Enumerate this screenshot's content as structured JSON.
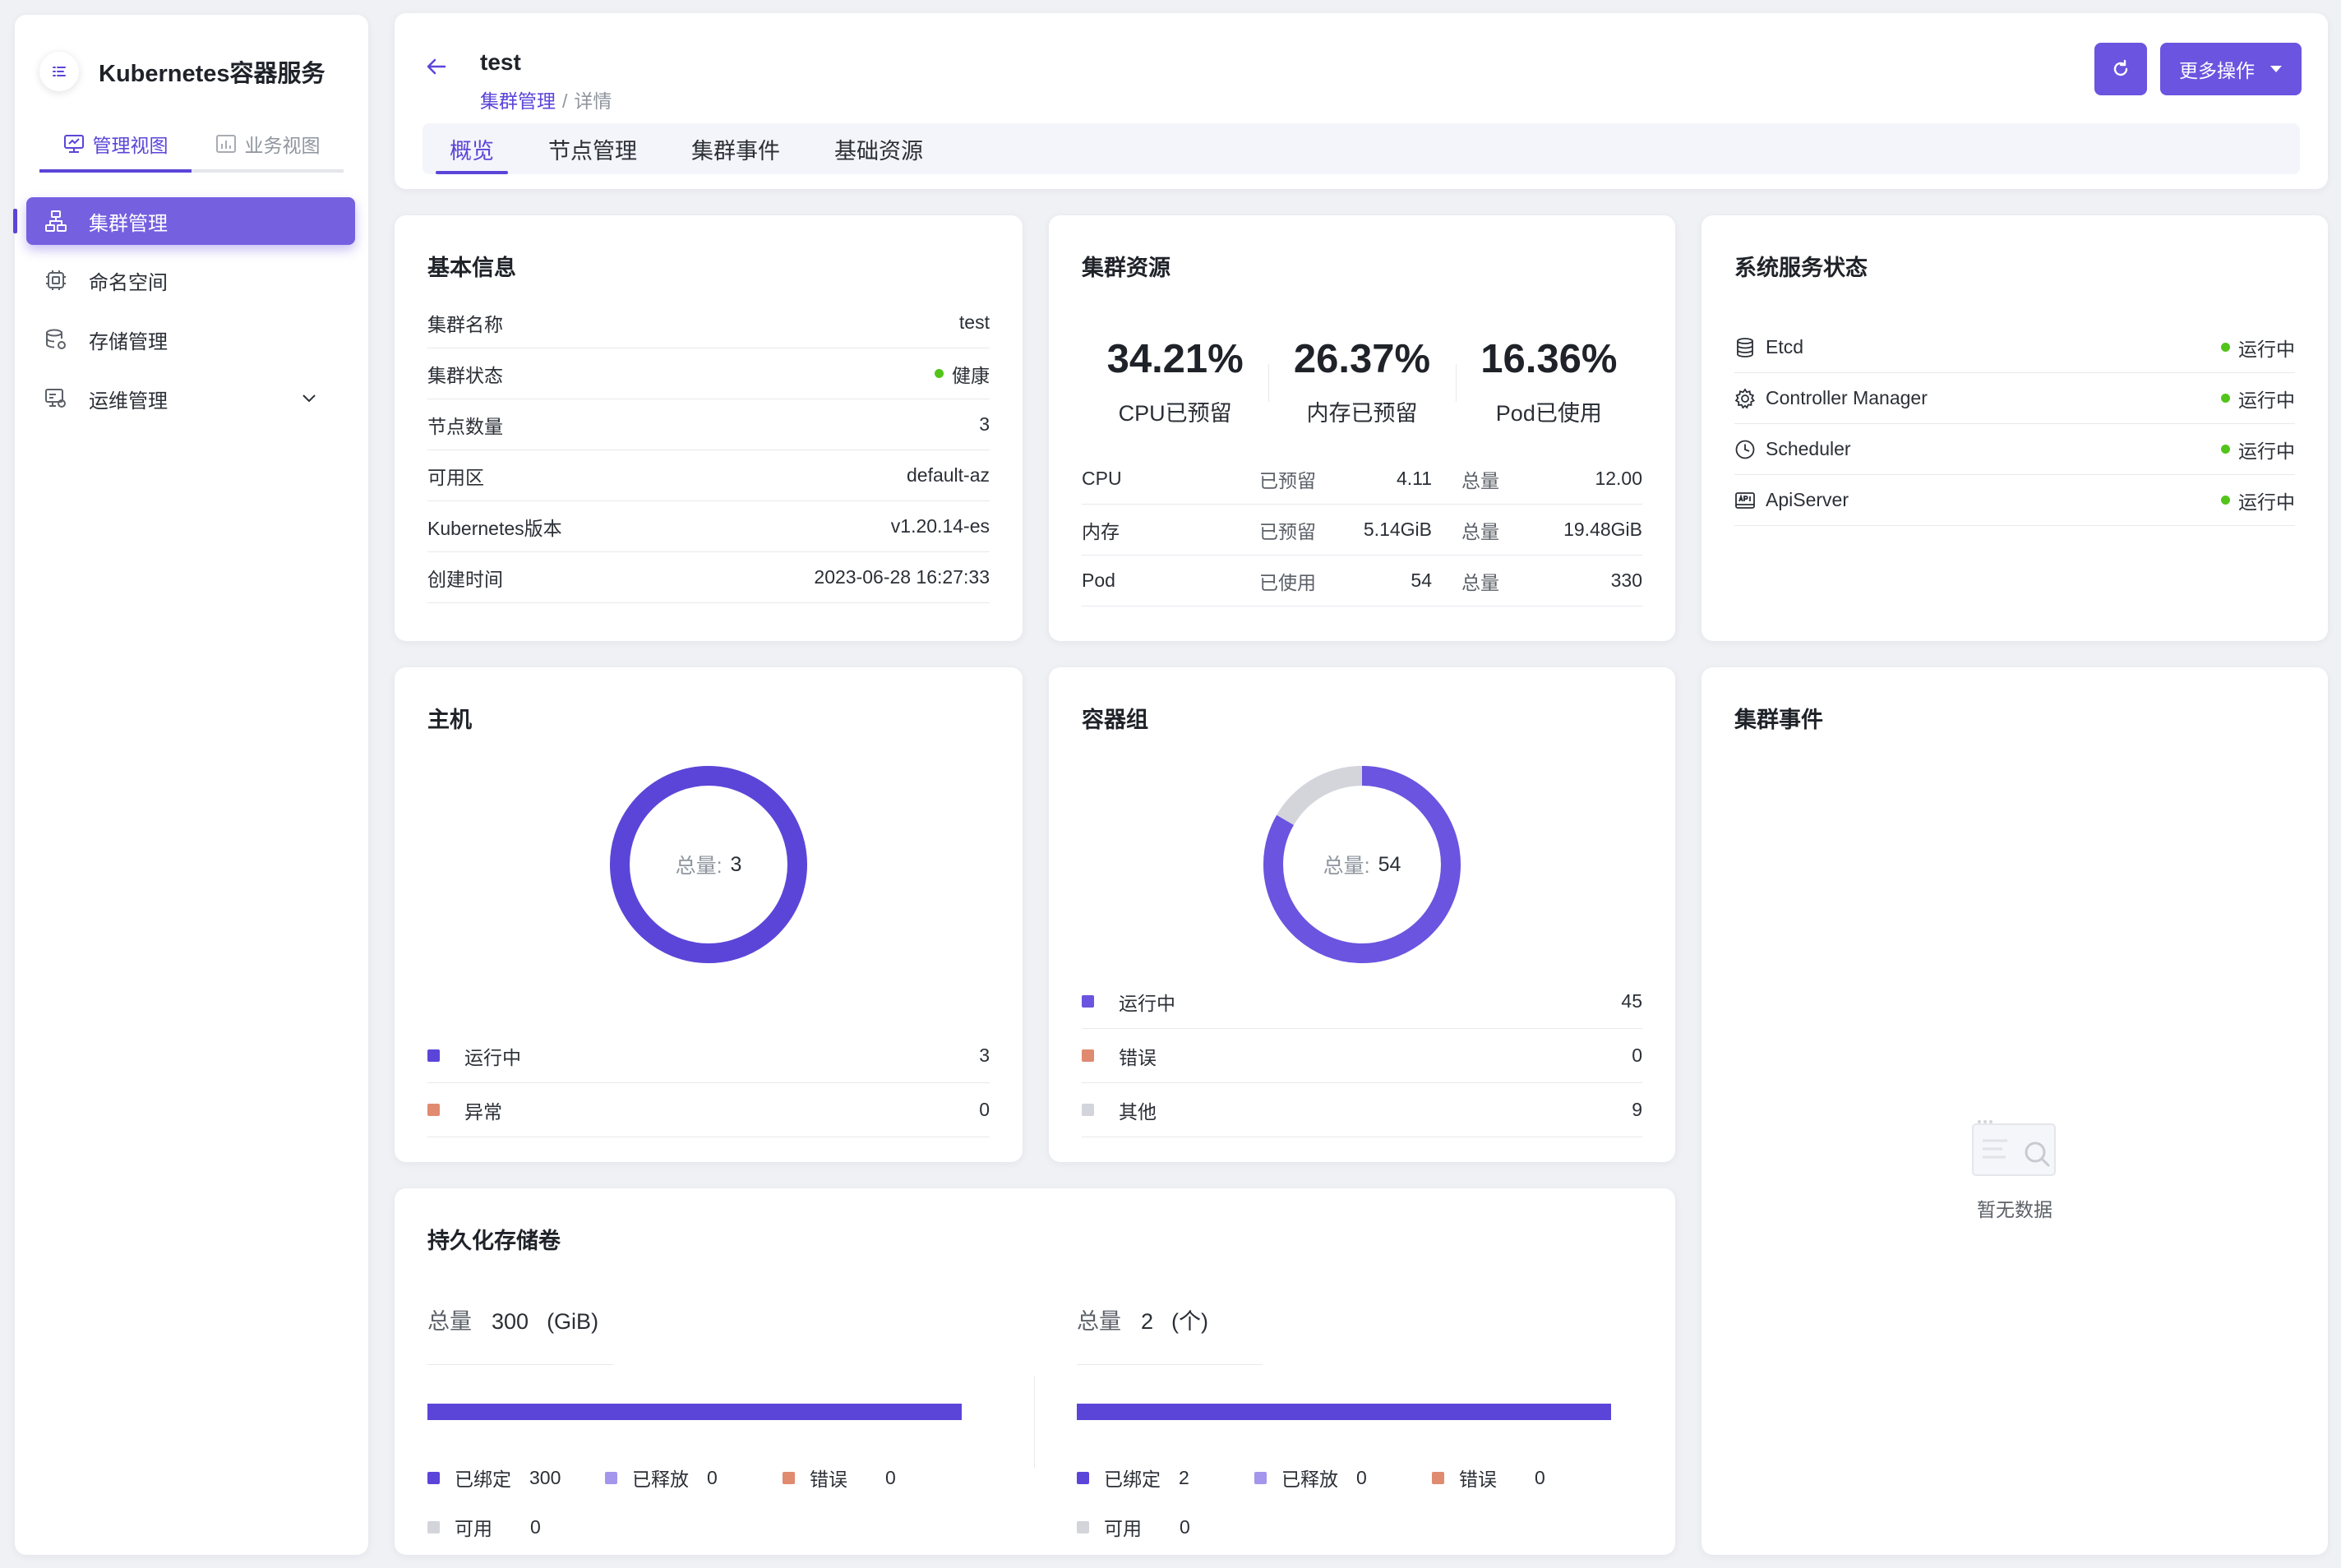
{
  "colors": {
    "primary": "#5b45d9",
    "primary_light": "#7560e0",
    "running": "#6b54e0",
    "error": "#e08a70",
    "other": "#d4d5db",
    "released": "#a396ec",
    "healthy": "#52c41a"
  },
  "sidebar": {
    "title": "Kubernetes容器服务",
    "view_tabs": [
      {
        "label": "管理视图",
        "icon": "monitor-icon",
        "active": true
      },
      {
        "label": "业务视图",
        "icon": "chart-board-icon",
        "active": false
      }
    ],
    "nav": [
      {
        "label": "集群管理",
        "icon": "cluster-icon",
        "active": true
      },
      {
        "label": "命名空间",
        "icon": "namespace-icon",
        "active": false
      },
      {
        "label": "存储管理",
        "icon": "storage-icon",
        "active": false
      },
      {
        "label": "运维管理",
        "icon": "ops-icon",
        "active": false,
        "expandable": true
      }
    ]
  },
  "header": {
    "title": "test",
    "breadcrumb_link": "集群管理",
    "breadcrumb_sep": "/",
    "breadcrumb_current": "详情",
    "more_label": "更多操作",
    "tabs": [
      {
        "label": "概览",
        "active": true
      },
      {
        "label": "节点管理",
        "active": false
      },
      {
        "label": "集群事件",
        "active": false
      },
      {
        "label": "基础资源",
        "active": false
      }
    ]
  },
  "basic_info": {
    "title": "基本信息",
    "rows": [
      {
        "label": "集群名称",
        "value": "test"
      },
      {
        "label": "集群状态",
        "value": "健康",
        "status": true
      },
      {
        "label": "节点数量",
        "value": "3"
      },
      {
        "label": "可用区",
        "value": "default-az"
      },
      {
        "label": "Kubernetes版本",
        "value": "v1.20.14-es"
      },
      {
        "label": "创建时间",
        "value": "2023-06-28 16:27:33"
      }
    ]
  },
  "cluster_resources": {
    "title": "集群资源",
    "stats": [
      {
        "value": "34.21%",
        "label": "CPU已预留"
      },
      {
        "value": "26.37%",
        "label": "内存已预留"
      },
      {
        "value": "16.36%",
        "label": "Pod已使用"
      }
    ],
    "rows": [
      {
        "name": "CPU",
        "used_label": "已预留",
        "used": "4.11",
        "total_label": "总量",
        "total": "12.00"
      },
      {
        "name": "内存",
        "used_label": "已预留",
        "used": "5.14GiB",
        "total_label": "总量",
        "total": "19.48GiB"
      },
      {
        "name": "Pod",
        "used_label": "已使用",
        "used": "54",
        "total_label": "总量",
        "total": "330"
      }
    ]
  },
  "system_services": {
    "title": "系统服务状态",
    "rows": [
      {
        "name": "Etcd",
        "icon": "database-icon",
        "status": "运行中"
      },
      {
        "name": "Controller Manager",
        "icon": "gear-icon",
        "status": "运行中"
      },
      {
        "name": "Scheduler",
        "icon": "clock-icon",
        "status": "运行中"
      },
      {
        "name": "ApiServer",
        "icon": "api-icon",
        "status": "运行中"
      }
    ]
  },
  "hosts": {
    "title": "主机",
    "total_label": "总量:",
    "total": "3",
    "legend": [
      {
        "name": "运行中",
        "value": 3,
        "color": "#5b45d9"
      },
      {
        "name": "异常",
        "value": 0,
        "color": "#e08a70"
      }
    ]
  },
  "pods": {
    "title": "容器组",
    "total_label": "总量:",
    "total": "54",
    "legend": [
      {
        "name": "运行中",
        "value": 45,
        "color": "#6b54e0"
      },
      {
        "name": "错误",
        "value": 0,
        "color": "#e08a70"
      },
      {
        "name": "其他",
        "value": 9,
        "color": "#d4d5db"
      }
    ]
  },
  "cluster_events": {
    "title": "集群事件",
    "empty_text": "暂无数据"
  },
  "persistent_volumes": {
    "title": "持久化存储卷",
    "capacity": {
      "total_label": "总量",
      "total": "300",
      "unit": "(GiB)",
      "bound_fraction": 1.0,
      "legend": [
        {
          "name": "已绑定",
          "value": "300",
          "color": "#5b45d9"
        },
        {
          "name": "已释放",
          "value": "0",
          "color": "#a396ec"
        },
        {
          "name": "错误",
          "value": "0",
          "color": "#e08a70"
        },
        {
          "name": "可用",
          "value": "0",
          "color": "#d4d5db"
        }
      ]
    },
    "count": {
      "total_label": "总量",
      "total": "2",
      "unit": "(个)",
      "bound_fraction": 1.0,
      "legend": [
        {
          "name": "已绑定",
          "value": "2",
          "color": "#5b45d9"
        },
        {
          "name": "已释放",
          "value": "0",
          "color": "#a396ec"
        },
        {
          "name": "错误",
          "value": "0",
          "color": "#e08a70"
        },
        {
          "name": "可用",
          "value": "0",
          "color": "#d4d5db"
        }
      ]
    }
  }
}
